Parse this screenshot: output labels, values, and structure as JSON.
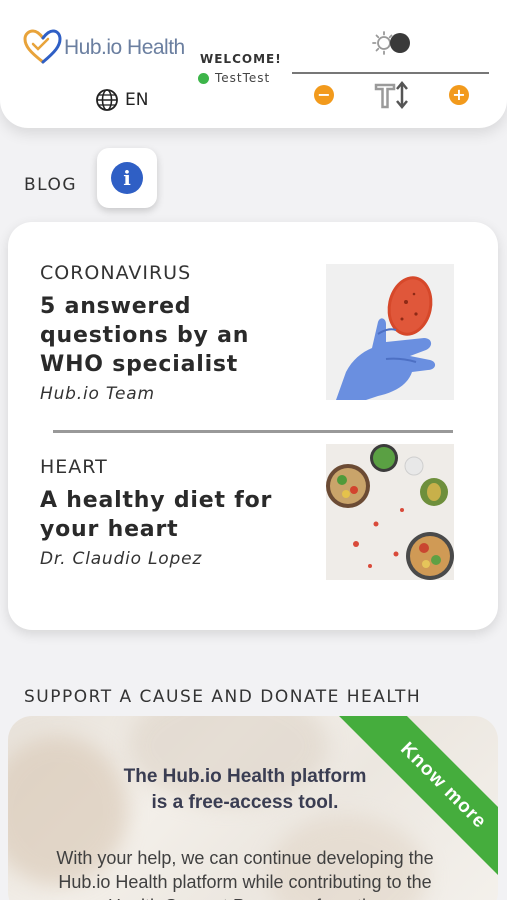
{
  "header": {
    "logo_text": "Hub.io Health",
    "language": "EN",
    "welcome": "WELCOME!",
    "username": "TestTest",
    "status_color": "#3db54a",
    "accent_color": "#f29a1c",
    "font_minus": "−",
    "font_plus": "+"
  },
  "blog": {
    "label": "BLOG",
    "info_icon": "i",
    "articles": [
      {
        "category": "CORONAVIRUS",
        "title": "5 answered questions by an WHO specialist",
        "author": "Hub.io Team",
        "image": "gloved-hand-petri-dish"
      },
      {
        "category": "HEART",
        "title": "A healthy diet for your heart",
        "author": "Dr. Claudio Lopez",
        "image": "healthy-food-bowls"
      }
    ]
  },
  "support": {
    "label": "SUPPORT A CAUSE AND DONATE HEALTH",
    "card_title": "The Hub.io Health platform is a free-access tool.",
    "card_text": "With your help, we can continue developing the Hub.io Health platform while contributing to the Health Support Programs from the",
    "ribbon": "Know more",
    "ribbon_color": "#45ad3d"
  }
}
